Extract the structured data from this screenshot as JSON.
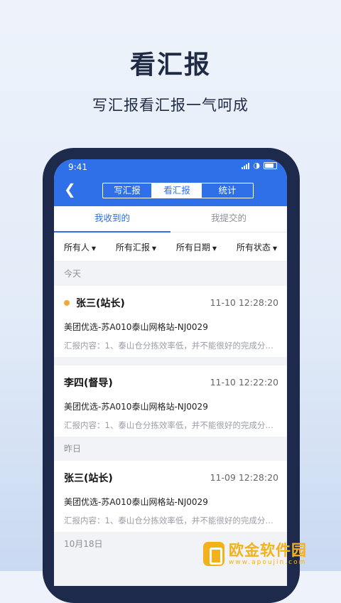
{
  "hero": {
    "title": "看汇报",
    "subtitle": "写汇报看汇报一气呵成"
  },
  "status_bar": {
    "time": "9:41"
  },
  "nav": {
    "segments": [
      "写汇报",
      "看汇报",
      "统计"
    ],
    "active_segment": "看汇报"
  },
  "tabs": [
    {
      "label": "我收到的",
      "active": true
    },
    {
      "label": "我提交的",
      "active": false
    }
  ],
  "filters": [
    "所有人",
    "所有汇报",
    "所有日期",
    "所有状态"
  ],
  "sections": [
    {
      "label": "今天",
      "reports": [
        {
          "name": "张三(站长)",
          "unread": true,
          "time": "11-10 12:28:20",
          "station": "美团优选-苏A010泰山网格站-NJ0029",
          "content": "汇报内容：1、泰山仓分拣效率低，并不能很好的完成分拣…"
        },
        {
          "name": "李四(督导)",
          "unread": false,
          "time": "11-10 12:22:20",
          "station": "美团优选-苏A010泰山网格站-NJ0029",
          "content": "汇报内容：1、泰山仓分拣效率低，并不能很好的完成分拣…"
        }
      ]
    },
    {
      "label": "昨日",
      "reports": [
        {
          "name": "张三(站长)",
          "unread": false,
          "time": "11-09 12:28:20",
          "station": "美团优选-苏A010泰山网格站-NJ0029",
          "content": "汇报内容：1、泰山仓分拣效率低，并不能很好的完成分拣…"
        }
      ]
    },
    {
      "label": "10月18日",
      "reports": []
    }
  ],
  "watermark": {
    "name": "欧金软件园",
    "site": "www.apoujin.com"
  },
  "colors": {
    "primary": "#2f6fe8",
    "unread_dot": "#f2a93b",
    "phone_frame": "#1e2a4c",
    "watermark": "#f3b21b"
  }
}
